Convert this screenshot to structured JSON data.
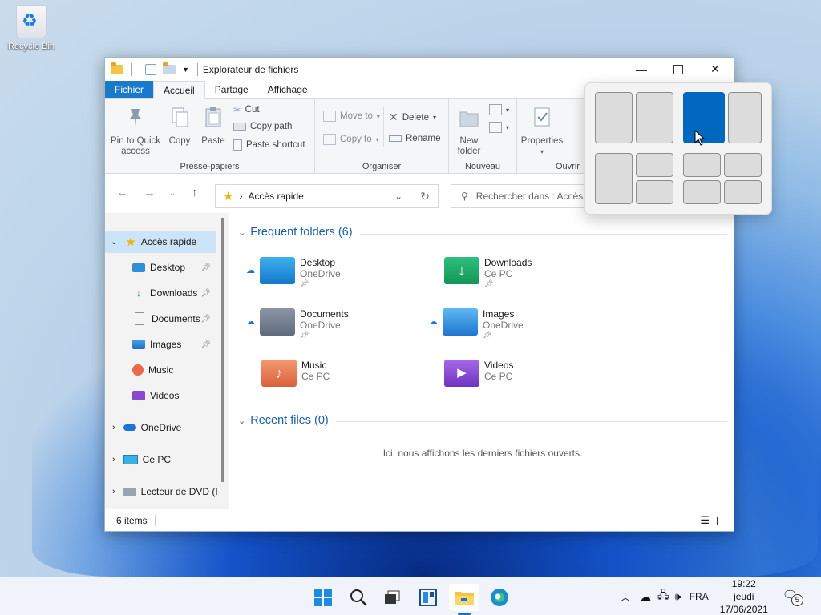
{
  "desktop": {
    "recycle_bin_label": "Recycle Bin"
  },
  "window": {
    "title": "Explorateur de fichiers",
    "controls": {
      "minimize": "—",
      "close": "✕"
    }
  },
  "ribbon": {
    "tabs": [
      "Fichier",
      "Accueil",
      "Partage",
      "Affichage"
    ],
    "active_tab": "Accueil",
    "clipboard": {
      "pin": "Pin to Quick access",
      "pin_line1": "Pin to Quick",
      "pin_line2": "access",
      "copy": "Copy",
      "paste": "Paste",
      "cut": "Cut",
      "copy_path": "Copy path",
      "paste_shortcut": "Paste shortcut",
      "label": "Presse-papiers"
    },
    "organize": {
      "move_to": "Move to",
      "copy_to": "Copy to",
      "delete": "Delete",
      "rename": "Rename",
      "label": "Organiser"
    },
    "new": {
      "new_folder_line1": "New",
      "new_folder_line2": "folder",
      "label": "Nouveau"
    },
    "open": {
      "properties": "Properties",
      "label": "Ouvrir"
    }
  },
  "navigation": {
    "address_text": "Accès rapide",
    "search_placeholder": "Rechercher dans : Accès"
  },
  "nav_pane": {
    "quick_access": "Accès rapide",
    "items": [
      {
        "label": "Desktop",
        "pinned": true
      },
      {
        "label": "Downloads",
        "pinned": true
      },
      {
        "label": "Documents",
        "pinned": true
      },
      {
        "label": "Images",
        "pinned": true
      },
      {
        "label": "Music",
        "pinned": false
      },
      {
        "label": "Videos",
        "pinned": false
      }
    ],
    "onedrive": "OneDrive",
    "this_pc": "Ce PC",
    "dvd": "Lecteur de DVD (I"
  },
  "content": {
    "frequent_header": "Frequent folders (6)",
    "folders": [
      {
        "name": "Desktop",
        "location": "OneDrive"
      },
      {
        "name": "Downloads",
        "location": "Ce PC"
      },
      {
        "name": "Documents",
        "location": "OneDrive"
      },
      {
        "name": "Images",
        "location": "OneDrive"
      },
      {
        "name": "Music",
        "location": "Ce PC"
      },
      {
        "name": "Videos",
        "location": "Ce PC"
      }
    ],
    "recent_header": "Recent files (0)",
    "recent_empty": "Ici, nous affichons les derniers fichiers ouverts."
  },
  "status": {
    "items_count": "6 items"
  },
  "taskbar": {
    "language": "FRA",
    "time": "19:22",
    "day": "jeudi",
    "date": "17/06/2021",
    "notification_count": "5"
  },
  "colors": {
    "accent": "#0067c0",
    "file_tab": "#1979ca",
    "link_header": "#1a5fa8"
  }
}
